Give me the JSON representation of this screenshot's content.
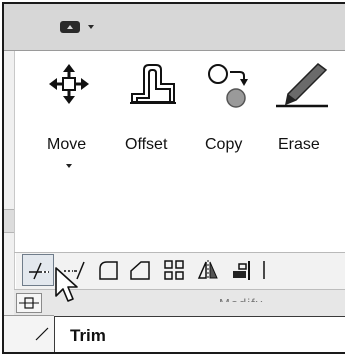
{
  "quick_access": {
    "icon": "workspace-icon",
    "dropdown_icon": "caret-down-icon"
  },
  "ribbon": {
    "big_tools": [
      {
        "label": "Move",
        "icon": "move-arrows-icon",
        "has_dropdown": true
      },
      {
        "label": "Offset",
        "icon": "offset-icon",
        "has_dropdown": false
      },
      {
        "label": "Copy",
        "icon": "copy-circles-icon",
        "has_dropdown": false
      },
      {
        "label": "Erase",
        "icon": "erase-pen-icon",
        "has_dropdown": false
      }
    ],
    "small_tools": [
      {
        "icon": "trim-icon",
        "active": true
      },
      {
        "icon": "extend-icon"
      },
      {
        "icon": "fillet-icon"
      },
      {
        "icon": "chamfer-icon"
      },
      {
        "icon": "array-icon"
      },
      {
        "icon": "mirror-icon"
      },
      {
        "icon": "align-icon"
      }
    ],
    "panel_title": "Modify"
  },
  "tooltip": {
    "text": "Trim"
  }
}
